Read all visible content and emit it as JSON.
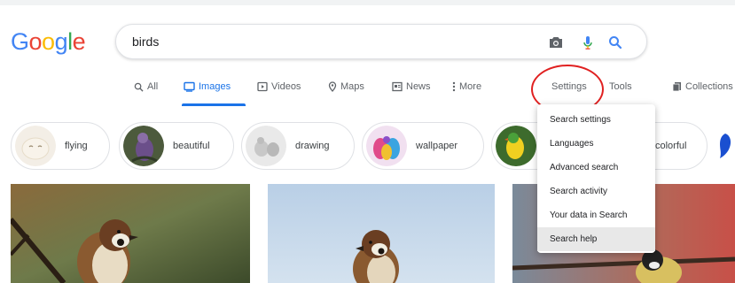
{
  "logo": {
    "letters": [
      "G",
      "o",
      "o",
      "g",
      "l",
      "e"
    ],
    "colors": [
      "#4285F4",
      "#EA4335",
      "#FBBC05",
      "#4285F4",
      "#34A853",
      "#EA4335"
    ]
  },
  "search": {
    "query": "birds",
    "camera_icon": "camera-icon",
    "mic_icon": "mic-icon",
    "search_icon": "search-icon"
  },
  "tabs": {
    "all": "All",
    "images": "Images",
    "videos": "Videos",
    "maps": "Maps",
    "news": "News",
    "more": "More",
    "settings": "Settings",
    "tools": "Tools",
    "collections": "Collections"
  },
  "chips": [
    {
      "label": "flying"
    },
    {
      "label": "beautiful"
    },
    {
      "label": "drawing"
    },
    {
      "label": "wallpaper"
    },
    {
      "label": "colorful"
    }
  ],
  "settings_menu": {
    "items": [
      "Search settings",
      "Languages",
      "Advanced search",
      "Search activity",
      "Your data in Search",
      "Search help"
    ],
    "hovered_item": "Search help"
  },
  "colors": {
    "accent": "#1a73e8",
    "highlight": "#e02020"
  }
}
